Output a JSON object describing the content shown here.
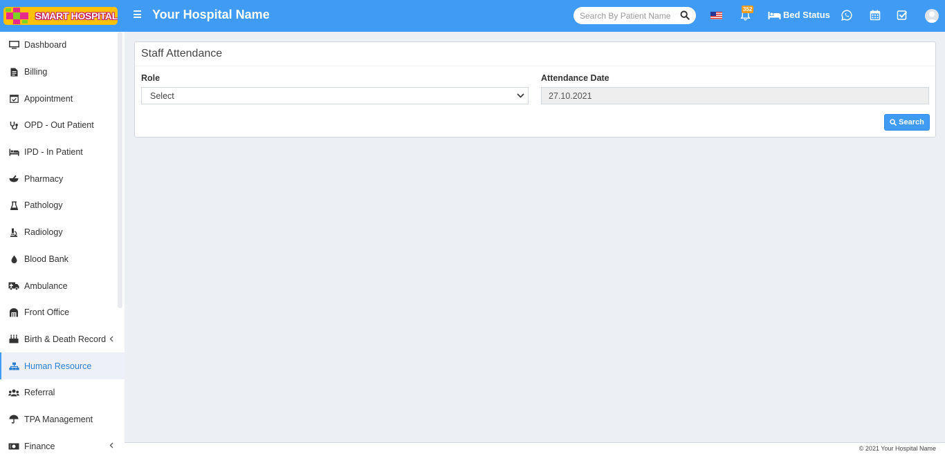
{
  "header": {
    "logo_text": "SMART HOSPITAL",
    "site_title": "Your Hospital Name",
    "search_placeholder": "Search By Patient Name",
    "notification_count": "352",
    "bed_status_label": "Bed Status",
    "accent_color": "#3f9bf3",
    "icons": [
      "menu-icon",
      "search-icon",
      "us-flag-icon",
      "bell-icon",
      "bed-icon",
      "whatsapp-icon",
      "calendar-icon",
      "task-check-icon",
      "user-avatar"
    ]
  },
  "sidebar": {
    "items": [
      {
        "label": "Dashboard",
        "icon": "monitor-icon"
      },
      {
        "label": "Billing",
        "icon": "file-invoice-icon"
      },
      {
        "label": "Appointment",
        "icon": "calendar-check-icon"
      },
      {
        "label": "OPD - Out Patient",
        "icon": "stethoscope-icon"
      },
      {
        "label": "IPD - In Patient",
        "icon": "procedure-bed-icon"
      },
      {
        "label": "Pharmacy",
        "icon": "mortar-pestle-icon"
      },
      {
        "label": "Pathology",
        "icon": "flask-icon"
      },
      {
        "label": "Radiology",
        "icon": "microscope-icon"
      },
      {
        "label": "Blood Bank",
        "icon": "tint-icon"
      },
      {
        "label": "Ambulance",
        "icon": "ambulance-icon"
      },
      {
        "label": "Front Office",
        "icon": "dungeon-icon"
      },
      {
        "label": "Birth & Death Record",
        "icon": "birthday-cake-icon",
        "has_submenu": true
      },
      {
        "label": "Human Resource",
        "icon": "sitemap-icon",
        "active": true
      },
      {
        "label": "Referral",
        "icon": "users-icon"
      },
      {
        "label": "TPA Management",
        "icon": "umbrella-icon"
      },
      {
        "label": "Finance",
        "icon": "money-bill-icon",
        "has_submenu": true
      }
    ]
  },
  "main": {
    "panel_title": "Staff Attendance",
    "role_label": "Role",
    "role_selected": "Select",
    "date_label": "Attendance Date",
    "date_value": "27.10.2021",
    "search_button": "Search"
  },
  "footer": {
    "text": "© 2021 Your Hospital Name"
  }
}
